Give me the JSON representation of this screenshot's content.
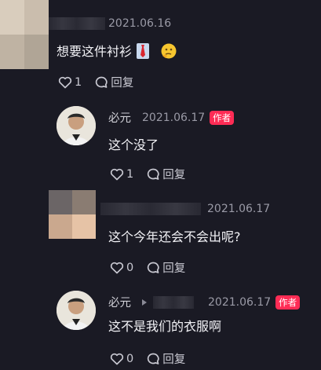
{
  "comments": [
    {
      "date": "2021.06.16",
      "text": "想要这件衬衫",
      "likes": "1",
      "reply_label": "回复"
    },
    {
      "name": "必元",
      "date": "2021.06.17",
      "badge": "作者",
      "text": "这个没了",
      "likes": "1",
      "reply_label": "回复"
    },
    {
      "date": "2021.06.17",
      "text": "这个今年还会不会出呢?",
      "likes": "0",
      "reply_label": "回复"
    },
    {
      "name": "必元",
      "date": "2021.06.17",
      "badge": "作者",
      "text": "这不是我们的衣服啊",
      "likes": "0",
      "reply_label": "回复"
    }
  ],
  "icons": {
    "like": "heart-outline-icon",
    "reply": "speech-bubble-icon",
    "emoji_1": "necktie-emoji",
    "emoji_2": "thinking-face-emoji",
    "reply_arrow": "caret-right-icon"
  },
  "colors": {
    "background": "#1a1a24",
    "author_badge": "#fe2c55"
  }
}
